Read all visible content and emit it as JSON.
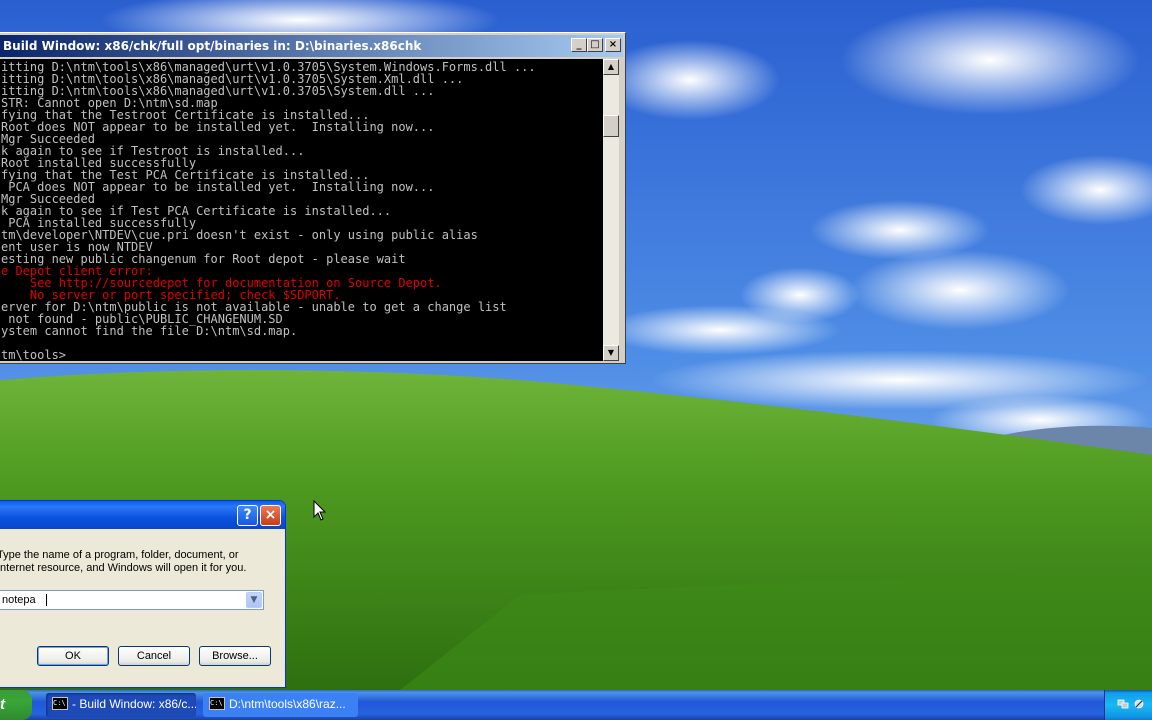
{
  "console": {
    "title": "Build Window: x86/chk/full opt/binaries in: D:\\binaries.x86chk",
    "lines": [
      {
        "text": "itting D:\\ntm\\tools\\x86\\managed\\urt\\v1.0.3705\\System.Windows.Forms.dll ...",
        "color": "#c0c0c0"
      },
      {
        "text": "itting D:\\ntm\\tools\\x86\\managed\\urt\\v1.0.3705\\System.Xml.dll ...",
        "color": "#c0c0c0"
      },
      {
        "text": "itting D:\\ntm\\tools\\x86\\managed\\urt\\v1.0.3705\\System.dll ...",
        "color": "#c0c0c0"
      },
      {
        "text": "STR: Cannot open D:\\ntm\\sd.map",
        "color": "#c0c0c0"
      },
      {
        "text": "fying that the Testroot Certificate is installed...",
        "color": "#c0c0c0"
      },
      {
        "text": "Root does NOT appear to be installed yet.  Installing now...",
        "color": "#c0c0c0"
      },
      {
        "text": "Mgr Succeeded",
        "color": "#c0c0c0"
      },
      {
        "text": "k again to see if Testroot is installed...",
        "color": "#c0c0c0"
      },
      {
        "text": "Root installed successfully",
        "color": "#c0c0c0"
      },
      {
        "text": "fying that the Test PCA Certificate is installed...",
        "color": "#c0c0c0"
      },
      {
        "text": " PCA does NOT appear to be installed yet.  Installing now...",
        "color": "#c0c0c0"
      },
      {
        "text": "Mgr Succeeded",
        "color": "#c0c0c0"
      },
      {
        "text": "k again to see if Test PCA Certificate is installed...",
        "color": "#c0c0c0"
      },
      {
        "text": " PCA installed successfully",
        "color": "#c0c0c0"
      },
      {
        "text": "tm\\developer\\NTDEV\\cue.pri doesn't exist - only using public alias",
        "color": "#c0c0c0"
      },
      {
        "text": "ent user is now NTDEV",
        "color": "#c0c0c0"
      },
      {
        "text": "esting new public changenum for Root depot - please wait",
        "color": "#c0c0c0"
      },
      {
        "text": "e Depot client error:",
        "color": "#e00000"
      },
      {
        "text": "    See http://sourcedepot for documentation on Source Depot.",
        "color": "#e00000"
      },
      {
        "text": "    No server or port specified; check $SDPORT.",
        "color": "#e00000"
      },
      {
        "text": "erver for D:\\ntm\\public is not available - unable to get a change list",
        "color": "#c0c0c0"
      },
      {
        "text": " not found - public\\PUBLIC_CHANGENUM.SD",
        "color": "#c0c0c0"
      },
      {
        "text": "ystem cannot find the file D:\\ntm\\sd.map.",
        "color": "#c0c0c0"
      },
      {
        "text": "",
        "color": "#c0c0c0"
      },
      {
        "text": "tm\\tools>",
        "color": "#c0c0c0"
      }
    ]
  },
  "run_dialog": {
    "prompt": "Type the name of a program, folder, document, or Internet resource, and Windows will open it for you.",
    "input_value": "notepa",
    "ok_label": "OK",
    "cancel_label": "Cancel",
    "browse_label": "Browse..."
  },
  "taskbar": {
    "start_label": "t",
    "tasks": [
      {
        "label": "- Build Window: x86/c..."
      },
      {
        "label": "D:\\ntm\\tools\\x86\\raz..."
      }
    ],
    "task_icon_text": "C:\\"
  },
  "colors": {
    "console_bg": "#000000",
    "console_text": "#c0c0c0",
    "error_text": "#e00000",
    "taskbar_blue": "#2157d7",
    "title_blue": "#0a246a"
  }
}
